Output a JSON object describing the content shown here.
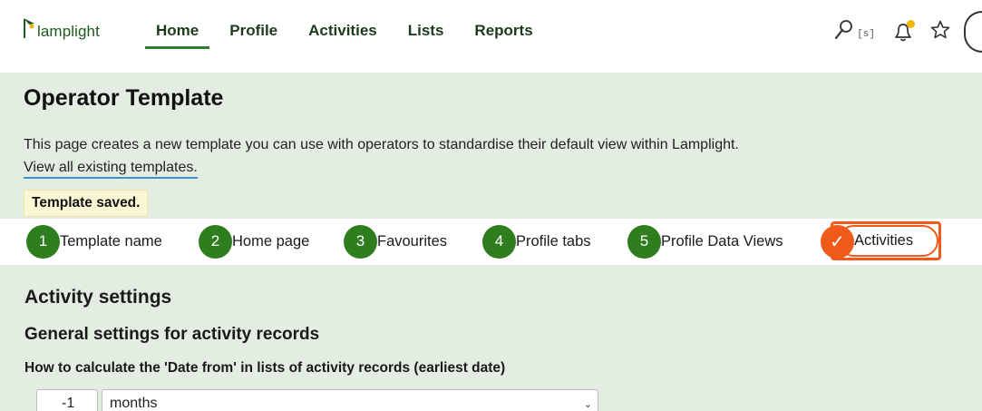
{
  "brand": {
    "name": "lamplight",
    "logo_icon": "lamp-icon",
    "accent": "#2e7d32"
  },
  "nav": {
    "items": [
      {
        "label": "Home",
        "active": true
      },
      {
        "label": "Profile",
        "active": false
      },
      {
        "label": "Activities",
        "active": false
      },
      {
        "label": "Lists",
        "active": false
      },
      {
        "label": "Reports",
        "active": false
      }
    ]
  },
  "tools": {
    "search_icon": "search-icon",
    "search_shortcut": "[s]",
    "notifications_icon": "bell-icon",
    "favourites_icon": "star-icon",
    "notification_dot_color": "#f2b705"
  },
  "page": {
    "title": "Operator Template",
    "intro": "This page creates a new template you can use with operators to standardise their default view within Lamplight.",
    "link": "View all existing templates.",
    "flash": "Template saved."
  },
  "steps": [
    {
      "number": "1",
      "label": "Template name"
    },
    {
      "number": "2",
      "label": "Home page"
    },
    {
      "number": "3",
      "label": "Favourites"
    },
    {
      "number": "4",
      "label": "Profile tabs"
    },
    {
      "number": "5",
      "label": "Profile Data Views"
    },
    {
      "number": "✓",
      "label": "Activities",
      "current": true
    }
  ],
  "colors": {
    "step_done": "#2e7d1f",
    "step_current": "#f05a1a",
    "panel_bg": "#e3ede2"
  },
  "settings": {
    "section_title": "Activity settings",
    "subsection_title": "General settings for activity records",
    "date_from_label": "How to calculate the 'Date from' in lists of activity records (earliest date)",
    "date_from_value": "-1",
    "date_from_unit": "months"
  }
}
